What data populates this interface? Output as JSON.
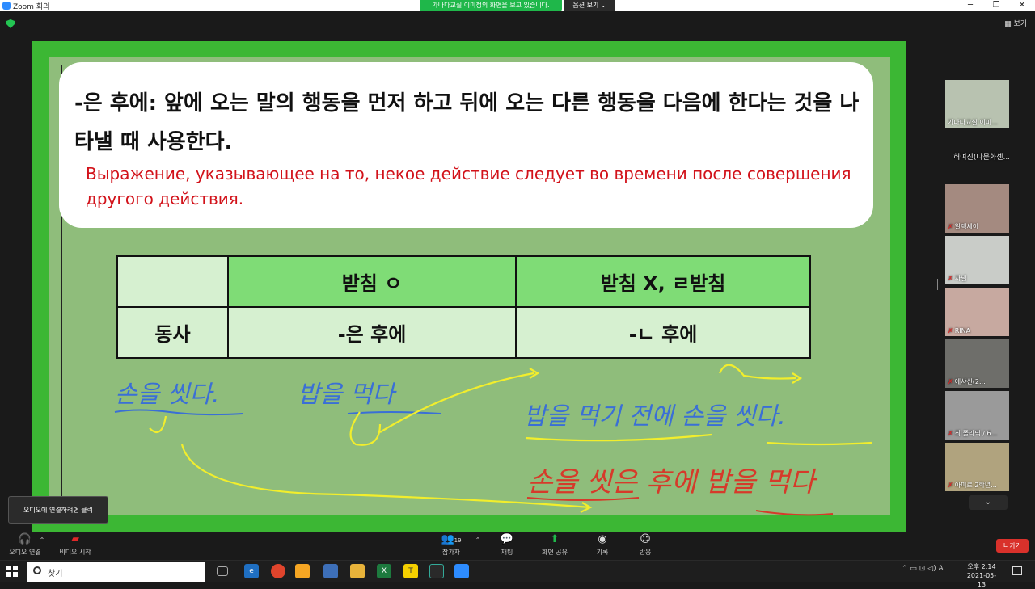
{
  "window": {
    "title": "Zoom 회의",
    "share_banner": "가나다교실 이미정의 화면을 보고 있습니다.",
    "view_options": "옵션 보기 ⌄",
    "view_button": "보기"
  },
  "slide": {
    "definition_ko": "-은 후에: 앞에 오는 말의 행동을 먼저 하고 뒤에 오는 다른 행동을 다음에 한다는 것을 나타낼 때 사용한다.",
    "definition_ru": "Выражение, указывающее на то, некое действие следует во времени после совершения другого действия.",
    "table": {
      "header_col1": "받침 ㅇ",
      "header_col2": "받침 X,  ㄹ받침",
      "row_label": "동사",
      "cell1": "-은 후에",
      "cell2": "-ㄴ 후에"
    }
  },
  "annotations": {
    "blue_line1_left": "손을 씻다.",
    "blue_line1_right": "밥을 먹다",
    "blue_line2": "밥을 먹기 전에 손을 씻다.",
    "red_line": "손을 씻은 후에 밥을 먹다",
    "colors": {
      "blue": "#3a6fd6",
      "red": "#d63a2a",
      "yellow": "#f2ee2c"
    }
  },
  "participants": [
    {
      "name": "가나다교실 이미...",
      "muted": false
    },
    {
      "name": "허여진(다문화센...",
      "muted": false,
      "video": false
    },
    {
      "name": "알렉세이",
      "muted": true
    },
    {
      "name": "자넬",
      "muted": true
    },
    {
      "name": "RINA",
      "muted": true
    },
    {
      "name": "에샤신(2...",
      "muted": true
    },
    {
      "name": "최 폴라딕 / 6...",
      "muted": true
    },
    {
      "name": "아미르 2학년...",
      "muted": true
    }
  ],
  "tooltip": "오디오에 연결하려면 클릭",
  "toolbar": {
    "audio": "오디오 연결",
    "video": "비디오 시작",
    "participants": "참가자",
    "participants_count": "19",
    "chat": "채팅",
    "share": "화면 공유",
    "record": "기록",
    "reactions": "반응",
    "leave": "나가기"
  },
  "taskbar": {
    "search_placeholder": "찾기",
    "clock_time": "오후 2:14",
    "clock_date": "2021-05-13",
    "tray_lang": "A"
  }
}
